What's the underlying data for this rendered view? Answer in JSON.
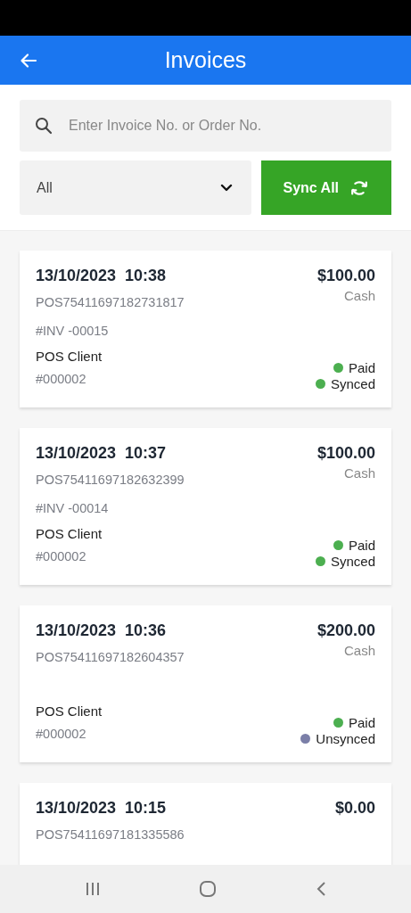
{
  "header": {
    "title": "Invoices"
  },
  "search": {
    "placeholder": "Enter Invoice No. or Order No."
  },
  "filter": {
    "value": "All"
  },
  "sync_button": {
    "label": "Sync All"
  },
  "invoices": [
    {
      "date_time": "13/10/2023  10:38",
      "order_no": "POS75411697182731817",
      "invoice_no": "#INV -00015",
      "customer": "POS Client",
      "customer_code": "#000002",
      "amount": "$100.00",
      "payment_method": "Cash",
      "statuses": [
        {
          "label": "Paid",
          "color": "#4caf50"
        },
        {
          "label": "Synced",
          "color": "#4caf50"
        }
      ]
    },
    {
      "date_time": "13/10/2023  10:37",
      "order_no": "POS75411697182632399",
      "invoice_no": "#INV -00014",
      "customer": "POS Client",
      "customer_code": "#000002",
      "amount": "$100.00",
      "payment_method": "Cash",
      "statuses": [
        {
          "label": "Paid",
          "color": "#4caf50"
        },
        {
          "label": "Synced",
          "color": "#4caf50"
        }
      ]
    },
    {
      "date_time": "13/10/2023  10:36",
      "order_no": "POS75411697182604357",
      "customer": "POS Client",
      "customer_code": "#000002",
      "amount": "$200.00",
      "payment_method": "Cash",
      "statuses": [
        {
          "label": "Paid",
          "color": "#4caf50"
        },
        {
          "label": "Unsynced",
          "color": "#7b7fa8"
        }
      ]
    },
    {
      "date_time": "13/10/2023  10:15",
      "order_no": "POS75411697181335586",
      "amount": "$0.00"
    }
  ]
}
